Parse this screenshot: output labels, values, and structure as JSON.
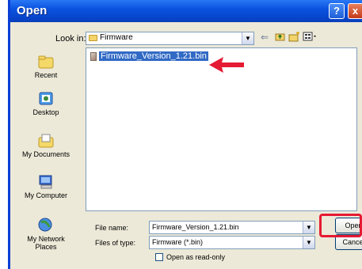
{
  "dialog": {
    "title": "Open"
  },
  "titlebar": {
    "help_label": "?",
    "close_label": "x"
  },
  "lookin": {
    "label": "Look in:",
    "value": "Firmware"
  },
  "places": [
    {
      "label": "Recent"
    },
    {
      "label": "Desktop"
    },
    {
      "label": "My Documents"
    },
    {
      "label": "My Computer"
    },
    {
      "label": "My Network Places"
    }
  ],
  "files": [
    {
      "name": "Firmware_Version_1.21.bin"
    }
  ],
  "filename": {
    "label": "File name:",
    "value": "Firmware_Version_1.21.bin"
  },
  "filetype": {
    "label": "Files of type:",
    "value": "Firmware (*.bin)"
  },
  "buttons": {
    "open": "Open",
    "cancel": "Cancel"
  },
  "readonly": {
    "label": "Open as read-only",
    "checked": false
  },
  "colors": {
    "title_bar": "#0a53e0",
    "selection": "#316ac5",
    "annotation": "#e51a33"
  }
}
